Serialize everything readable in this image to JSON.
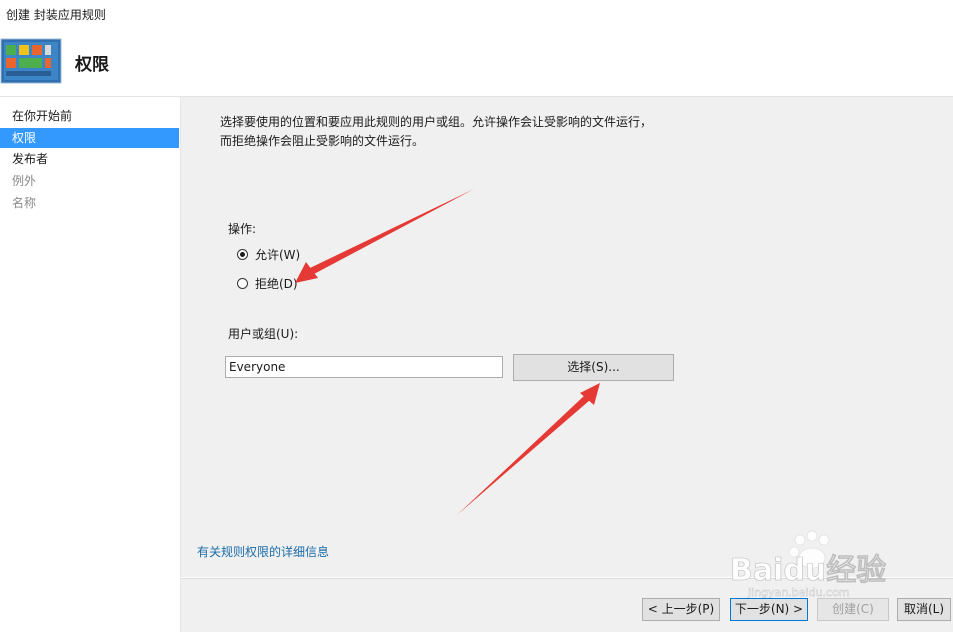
{
  "window": {
    "title": "创建 封装应用规则"
  },
  "header": {
    "title": "权限",
    "icon": "app-grid-icon"
  },
  "sidebar": {
    "items": [
      {
        "label": "在你开始前",
        "state": "normal"
      },
      {
        "label": "权限",
        "state": "active"
      },
      {
        "label": "发布者",
        "state": "normal"
      },
      {
        "label": "例外",
        "state": "disabled"
      },
      {
        "label": "名称",
        "state": "disabled"
      }
    ]
  },
  "main": {
    "description_line1": "选择要使用的位置和要应用此规则的用户或组。允许操作会让受影响的文件运行，",
    "description_line2": "而拒绝操作会阻止受影响的文件运行。",
    "action_label": "操作:",
    "radio_allow": "允许(W)",
    "radio_deny": "拒绝(D)",
    "selected_action": "allow",
    "user_group_label": "用户或组(U):",
    "user_group_value": "Everyone",
    "select_button": "选择(S)...",
    "info_link": "有关规则权限的详细信息"
  },
  "footer": {
    "back_button": "< 上一步(P)",
    "next_button": "下一步(N) >",
    "create_button": "创建(C)",
    "cancel_button": "取消(L)"
  },
  "watermark": {
    "brand": "Baidu经验",
    "url": "jingyan.baidu.com"
  },
  "colors": {
    "accent": "#3399ff",
    "link": "#1a6ba8",
    "annotation_arrow": "#e53935",
    "content_bg": "#f0f0f0"
  }
}
